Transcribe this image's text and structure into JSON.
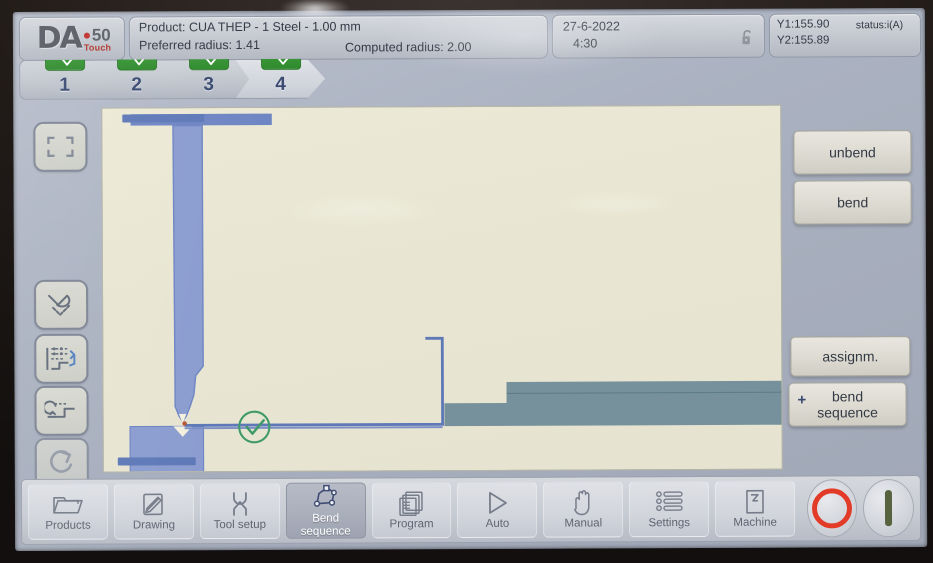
{
  "brand": {
    "logo_text": "DA",
    "model": "50",
    "sub": "Touch"
  },
  "header": {
    "product_line": "Product: CUA  THEP - 1 Steel - 1.00 mm",
    "preferred_radius": "Preferred radius: 1.41",
    "computed_radius": "Computed radius: 2.00",
    "date": "27-6-2022",
    "time": "4:30",
    "lock_icon": "unlocked-padlock-icon",
    "y1": "Y1:155.90",
    "y2": "Y2:155.89",
    "status": "status:i(A)"
  },
  "step_tabs": [
    {
      "num": "1",
      "chip": "bend-profile-icon",
      "active": false
    },
    {
      "num": "2",
      "chip": "bend-profile-icon",
      "active": false
    },
    {
      "num": "3",
      "chip": "bend-profile-icon",
      "active": false
    },
    {
      "num": "4",
      "chip": "bend-profile-icon",
      "active": true
    }
  ],
  "left_tools": [
    {
      "name": "view-fit-rectangle-icon",
      "title": "fit view"
    },
    {
      "name": "flip-part-icon",
      "title": "flip part"
    },
    {
      "name": "bend-step-detail-icon",
      "title": "bend step detail"
    },
    {
      "name": "rotate-part-icon",
      "title": "rotate part"
    },
    {
      "name": "undo-icon",
      "title": "undo"
    }
  ],
  "right_buttons": {
    "unbend": "unbend",
    "bend": "bend",
    "assignm": "assignm.",
    "sequence_plus": "+",
    "sequence_line1": "bend",
    "sequence_line2": "sequence"
  },
  "taskbar": [
    {
      "label": "Products",
      "icon": "folder-icon",
      "active": false
    },
    {
      "label": "Drawing",
      "icon": "pencil-page-icon",
      "active": false
    },
    {
      "label": "Tool setup",
      "icon": "punch-die-icon",
      "active": false
    },
    {
      "label": "Bend sequence",
      "icon": "polygon-nodes-icon",
      "active": true
    },
    {
      "label": "Program",
      "icon": "stacked-pages-icon",
      "active": false
    },
    {
      "label": "Auto",
      "icon": "play-triangle-icon",
      "active": false
    },
    {
      "label": "Manual",
      "icon": "hand-icon",
      "active": false
    },
    {
      "label": "Settings",
      "icon": "sliders-icon",
      "active": false
    },
    {
      "label": "Machine",
      "icon": "machine-page-icon",
      "active": false
    }
  ],
  "machine_controls": {
    "stop": "emergency-stop-button",
    "start": "start-button"
  },
  "colors": {
    "screen_bg": "#aab1c0",
    "canvas_bg": "#e8e6d2",
    "tool_blue": "#8095c8",
    "sheet_blue": "#6f86c4",
    "gauge_grey": "#76919b",
    "chip_green": "#2f8a2d",
    "stop_red": "#e23b28",
    "start_green": "#57623f",
    "tab_num_blue": "#3a4a72"
  },
  "canvas": {
    "ok_marker": "green-check-circle-icon",
    "description": "press brake side view: upper punch, lower die, sheet metal part and backgauge"
  }
}
